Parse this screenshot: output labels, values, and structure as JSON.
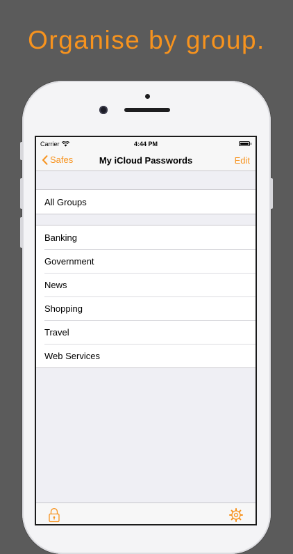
{
  "headline": "Organise by group.",
  "status_bar": {
    "carrier": "Carrier",
    "time": "4:44 PM"
  },
  "nav": {
    "back_label": "Safes",
    "title": "My iCloud Passwords",
    "edit_label": "Edit"
  },
  "sections": [
    {
      "rows": [
        "All Groups"
      ]
    },
    {
      "rows": [
        "Banking",
        "Government",
        "News",
        "Shopping",
        "Travel",
        "Web Services"
      ]
    }
  ],
  "tab_bar": {
    "left_icon": "lock-icon",
    "right_icon": "gear-icon"
  },
  "colors": {
    "accent": "#f7931e",
    "background": "#5b5b5b",
    "table_background": "#efeff4"
  }
}
